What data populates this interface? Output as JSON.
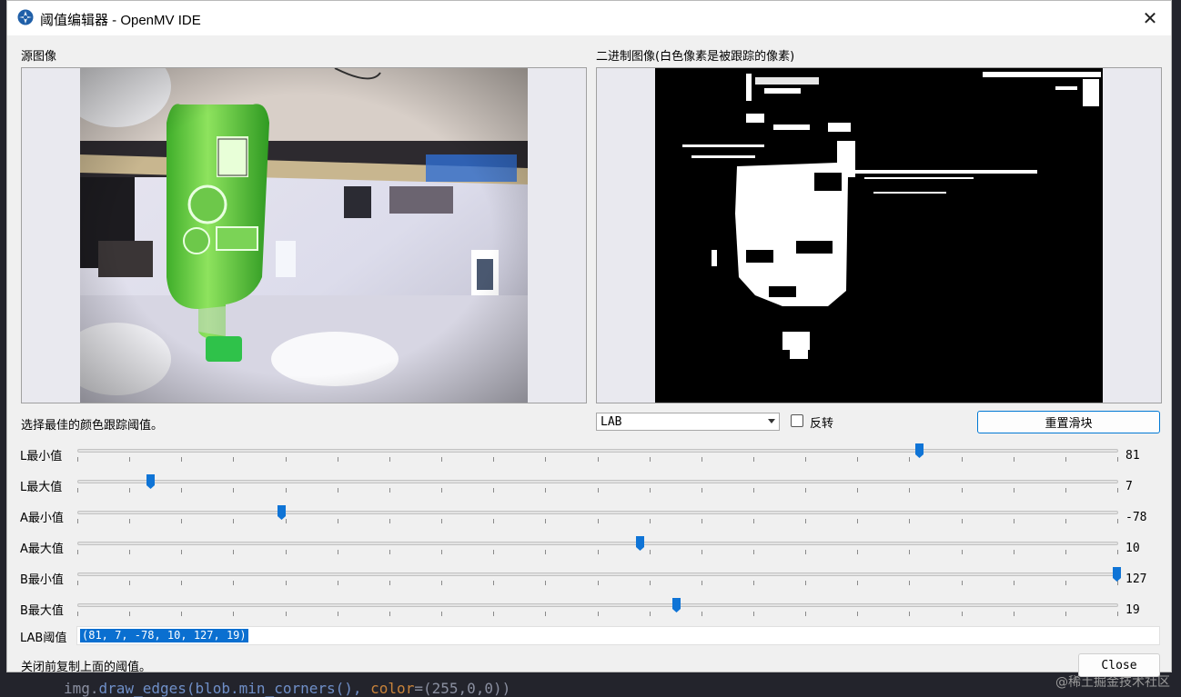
{
  "background": {
    "code_prefix": "img.",
    "code_call": "draw_edges(blob.min_corners(), ",
    "code_arg": "color",
    "code_tail": "=(255,0,0))",
    "watermark": "@稀土掘金技术社区"
  },
  "window": {
    "title": "阈值编辑器 - OpenMV IDE",
    "close_glyph": "✕"
  },
  "panels": {
    "source_label": "源图像",
    "binary_label": "二进制图像(白色像素是被跟踪的像素)"
  },
  "controls": {
    "hint": "选择最佳的颜色跟踪阈值。",
    "color_space": "LAB",
    "invert_label": "反转",
    "invert_checked": false,
    "reset_label": "重置滑块"
  },
  "sliders": [
    {
      "label": "L最小值",
      "value": "81",
      "min": 0,
      "max": 100
    },
    {
      "label": "L最大值",
      "value": "7",
      "min": 0,
      "max": 100
    },
    {
      "label": "A最小值",
      "value": "-78",
      "min": -128,
      "max": 127
    },
    {
      "label": "A最大值",
      "value": "10",
      "min": -128,
      "max": 127
    },
    {
      "label": "B最小值",
      "value": "127",
      "min": -128,
      "max": 127
    },
    {
      "label": "B最大值",
      "value": "19",
      "min": -128,
      "max": 127
    }
  ],
  "threshold": {
    "label": "LAB阈值",
    "value": "(81, 7, -78, 10, 127, 19)"
  },
  "footer": {
    "hint": "关闭前复制上面的阈值。",
    "close_label": "Close"
  },
  "colors": {
    "accent": "#0a6fd0",
    "handle": "#0f74d6"
  }
}
